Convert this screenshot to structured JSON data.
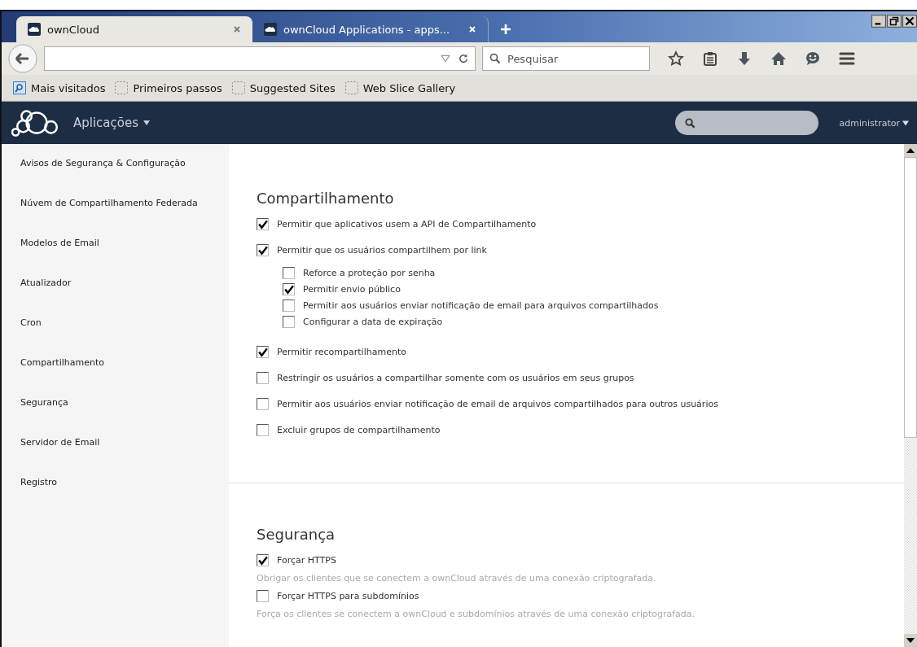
{
  "browser": {
    "tabs": [
      {
        "label": "ownCloud",
        "selected": true
      },
      {
        "label": "ownCloud Applications - apps...",
        "selected": false
      }
    ],
    "search": {
      "placeholder": "Pesquisar"
    },
    "bookmarks": [
      {
        "label": "Mais visitados",
        "kind": "special"
      },
      {
        "label": "Primeiros passos",
        "kind": "folder"
      },
      {
        "label": "Suggested Sites",
        "kind": "folder"
      },
      {
        "label": "Web Slice Gallery",
        "kind": "folder"
      }
    ]
  },
  "header": {
    "app_menu": "Aplicações",
    "user": "administrator"
  },
  "sidebar": {
    "items": [
      {
        "label": "Avisos de Segurança & Configuração"
      },
      {
        "label": "Núvem de Compartilhamento Federada"
      },
      {
        "label": "Modelos de Email"
      },
      {
        "label": "Atualizador"
      },
      {
        "label": "Cron"
      },
      {
        "label": "Compartilhamento"
      },
      {
        "label": "Segurança"
      },
      {
        "label": "Servidor de Email"
      },
      {
        "label": "Registro"
      }
    ]
  },
  "sections": [
    {
      "title": "Compartilhamento",
      "options": [
        {
          "label": "Permitir que aplicativos usem a API de Compartilhamento",
          "checked": true
        },
        {
          "label": "Permitir que os usuários compartilhem por link",
          "checked": true,
          "children": [
            {
              "label": "Reforce a proteção por senha",
              "checked": false
            },
            {
              "label": "Permitir envio público",
              "checked": true
            },
            {
              "label": "Permitir aos usuários enviar notificação de email para arquivos compartilhados",
              "checked": false
            },
            {
              "label": "Configurar a data de expiração",
              "checked": false
            }
          ]
        },
        {
          "label": "Permitir recompartilhamento",
          "checked": true
        },
        {
          "label": "Restringir os usuários a compartilhar somente com os usuários em seus grupos",
          "checked": false
        },
        {
          "label": "Permitir aos usuários enviar notificação de email de arquivos compartilhados para outros usuários",
          "checked": false
        },
        {
          "label": "Excluir grupos de compartilhamento",
          "checked": false
        }
      ]
    },
    {
      "title": "Segurança",
      "options": [
        {
          "label": "Forçar HTTPS",
          "checked": true,
          "description": "Obrigar os clientes que se conectem a ownCloud através de uma conexão criptografada."
        },
        {
          "label": "Forçar HTTPS para subdomínios",
          "checked": false,
          "description": "Força os clientes se conectem a ownCloud e subdomínios através de uma conexão criptografada."
        }
      ]
    }
  ]
}
